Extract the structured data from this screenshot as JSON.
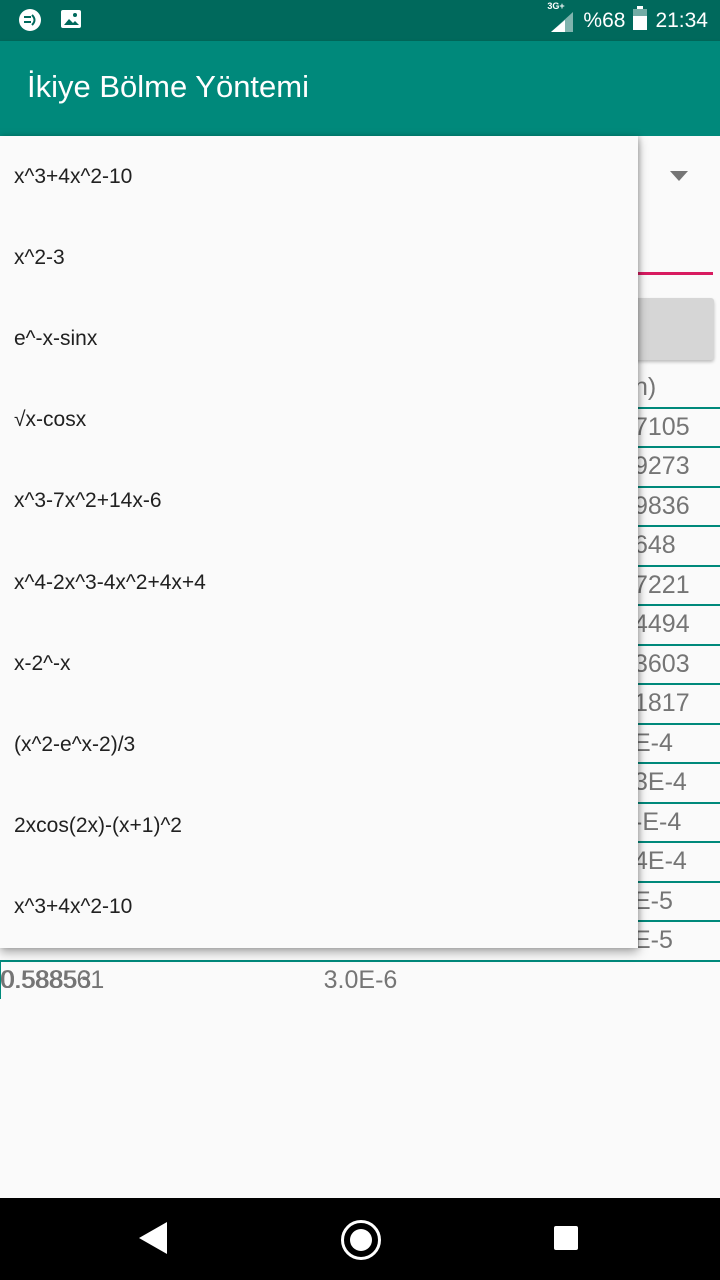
{
  "status_bar": {
    "battery_text": "%68",
    "time": "21:34",
    "network": "3G+"
  },
  "app_bar": {
    "title": "İkiye Bölme Yöntemi"
  },
  "dropdown": {
    "items": [
      "x^3+4x^2-10",
      "x^2-3",
      "e^-x-sinx",
      "√x-cosx",
      "x^3-7x^2+14x-6",
      "x^4-2x^3-4x^2+4x+4",
      "x-2^-x",
      "(x^2-e^x-2)/3",
      "2xcos(2x)-(x+1)^2",
      "x^3+4x^2-10"
    ]
  },
  "results_table": {
    "rows": [
      [
        "",
        "",
        "",
        "n)"
      ],
      [
        "",
        "",
        "",
        "7105"
      ],
      [
        "",
        "",
        "",
        "9273"
      ],
      [
        "",
        "",
        "",
        "9836"
      ],
      [
        "",
        "",
        "",
        "648"
      ],
      [
        "",
        "",
        "",
        "7221"
      ],
      [
        "",
        "",
        "",
        "4494"
      ],
      [
        "",
        "",
        "",
        "3603"
      ],
      [
        "",
        "",
        "",
        "1817"
      ],
      [
        "",
        "",
        "",
        "E-4"
      ],
      [
        "",
        "",
        "",
        "3E-4"
      ],
      [
        "",
        "",
        "",
        "-E-4"
      ],
      [
        "",
        "",
        "",
        "4E-4"
      ],
      [
        "",
        "",
        "",
        "E-5"
      ],
      [
        "",
        "",
        "",
        "E-5"
      ],
      [
        "0.588561",
        "0.5885",
        "0.58853",
        "3.0E-6"
      ]
    ]
  },
  "colors": {
    "status_bar": "#00695c",
    "app_bar": "#00897b",
    "accent": "#d81b60",
    "table_lines": "#00897b"
  }
}
